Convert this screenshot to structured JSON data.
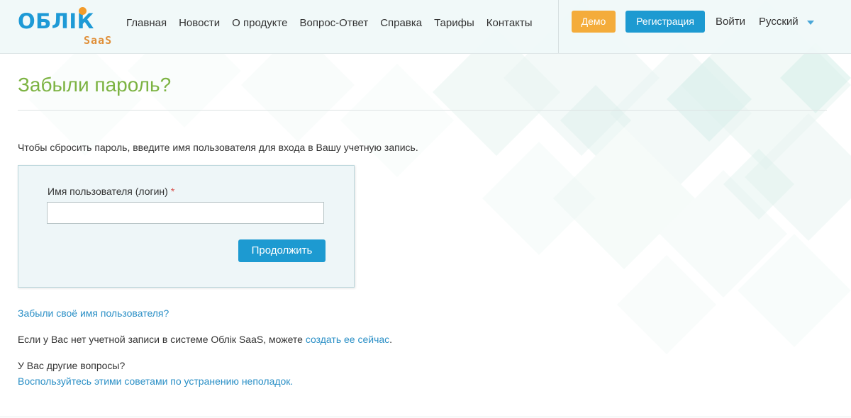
{
  "brand": {
    "logo_main": "ОБЛІК",
    "logo_sub": "SaaS",
    "primary_color": "#1e9ad6",
    "accent_color": "#f39c2b",
    "title_color": "#7cb342"
  },
  "nav": {
    "items": [
      {
        "label": "Главная"
      },
      {
        "label": "Новости"
      },
      {
        "label": "О продукте"
      },
      {
        "label": "Вопрос-Ответ"
      },
      {
        "label": "Справка"
      },
      {
        "label": "Тарифы"
      },
      {
        "label": "Контакты"
      }
    ]
  },
  "header_actions": {
    "demo_label": "Демо",
    "register_label": "Регистрация",
    "login_label": "Войти",
    "language_label": "Русский"
  },
  "page": {
    "title": "Забыли пароль?",
    "intro": "Чтобы сбросить пароль, введите имя пользователя для входа в Вашу учетную запись."
  },
  "form": {
    "username_label": "Имя пользователя (логин)",
    "required_mark": "*",
    "username_value": "",
    "submit_label": "Продолжить"
  },
  "links": {
    "forgot_username": "Забыли своё имя пользователя?",
    "no_account_text": "Если у Вас нет учетной записи в системе Облік SaaS, можете ",
    "create_now": "создать ее сейчас",
    "no_account_suffix": ".",
    "other_questions": "У Вас другие вопросы?",
    "troubleshooting": "Воспользуйтесь этими советами по устранению неполадок."
  }
}
